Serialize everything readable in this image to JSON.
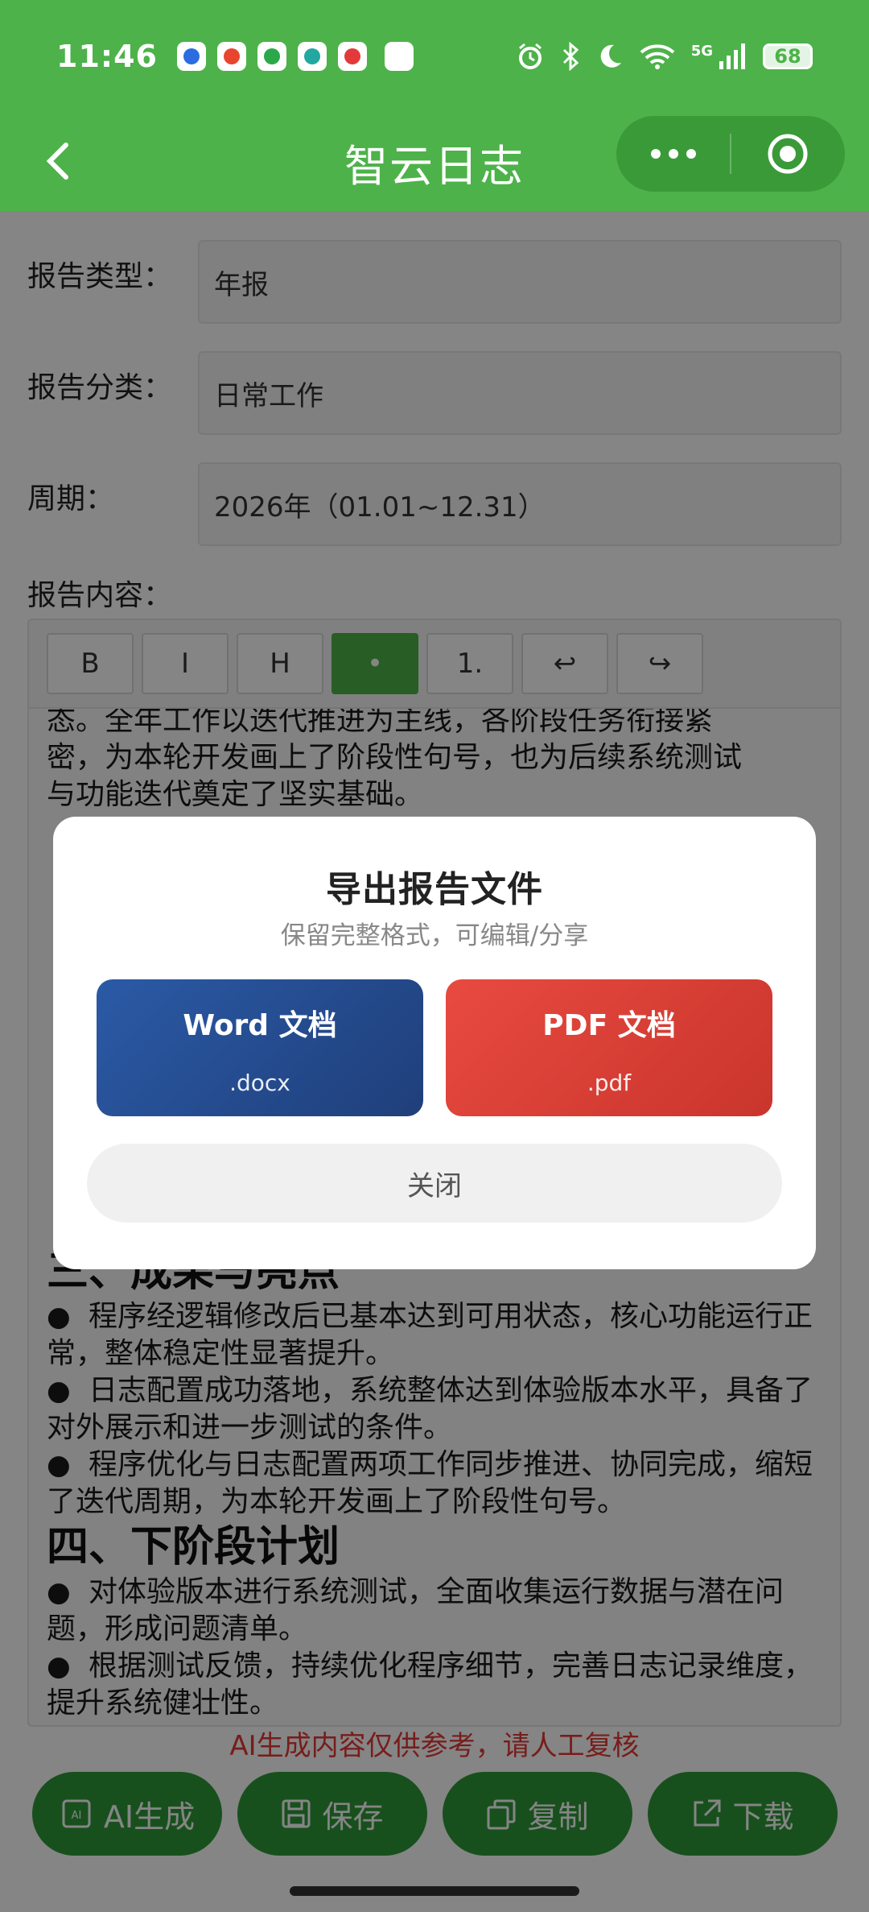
{
  "status_bar": {
    "time": "11:46",
    "battery": "68",
    "network": "5G"
  },
  "header": {
    "title": "智云日志"
  },
  "form": {
    "report_type_label": "报告类型：",
    "report_type_value": "年报",
    "category_label": "报告分类：",
    "category_value": "日常工作",
    "period_label": "周期：",
    "period_value": "2026年（01.01~12.31）",
    "content_label": "报告内容："
  },
  "toolbar": {
    "bold": "B",
    "italic": "I",
    "heading": "H",
    "bullet": "•",
    "ordered": "1.",
    "undo": "↩",
    "redo": "↪"
  },
  "document": {
    "para_top_partial": "态。全年工作以迭代推进为主线，各阶段任务衔接紧",
    "para_top_line2": "密，为本轮开发画上了阶段性句号，也为后续系统测试",
    "para_top_line3": "与功能迭代奠定了坚实基础。",
    "section3_title": "三、成果与亮点",
    "section3_items": [
      "程序经逻辑修改后已基本达到可用状态，核心功能运行正常，整体稳定性显著提升。",
      "日志配置成功落地，系统整体达到体验版本水平，具备了对外展示和进一步测试的条件。",
      "程序优化与日志配置两项工作同步推进、协同完成，缩短了迭代周期，为本轮开发画上了阶段性句号。"
    ],
    "section4_title": "四、下阶段计划",
    "section4_items": [
      "对体验版本进行系统测试，全面收集运行数据与潜在问题，形成问题清单。",
      "根据测试反馈，持续优化程序细节，完善日志记录维度，提升系统健壮性。"
    ]
  },
  "disclaimer": "AI生成内容仅供参考，请人工复核",
  "actions": {
    "ai": "AI生成",
    "save": "保存",
    "copy": "复制",
    "download": "下载"
  },
  "modal": {
    "title": "导出报告文件",
    "subtitle": "保留完整格式，可编辑/分享",
    "word_label": "Word 文档",
    "word_ext": ".docx",
    "pdf_label": "PDF 文档",
    "pdf_ext": ".pdf",
    "close": "关闭"
  },
  "colors": {
    "brand_green": "#4db24a",
    "button_green": "#2f9a39",
    "word_blue": "#2b5aa6",
    "pdf_red": "#e84a40",
    "warning_red": "#e53935"
  }
}
